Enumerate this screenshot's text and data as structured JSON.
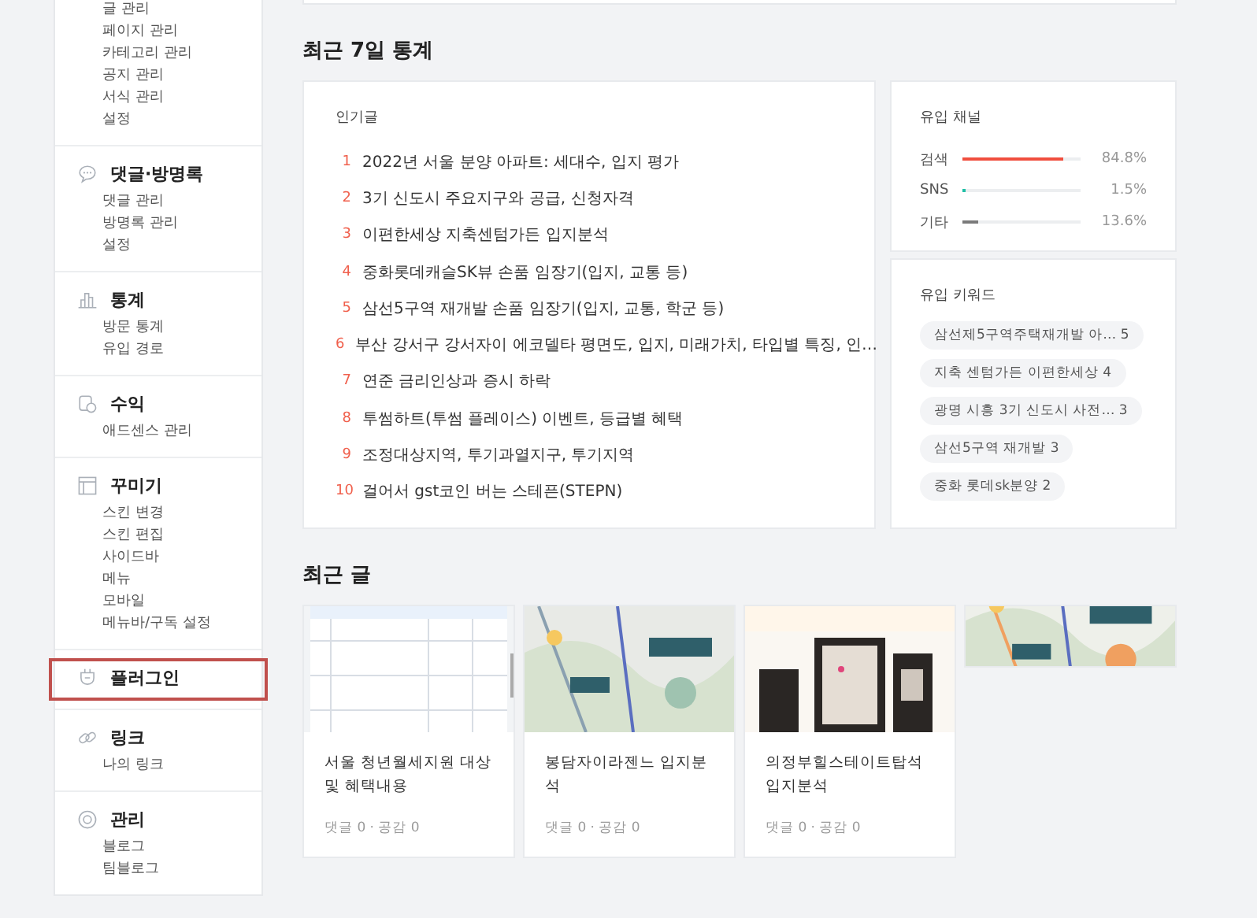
{
  "sidebar": {
    "sections": [
      {
        "highlighted": false,
        "items": [
          "글 관리",
          "페이지 관리",
          "카테고리 관리",
          "공지 관리",
          "서식 관리",
          "설정"
        ]
      },
      {
        "title": "댓글·방명록",
        "kind": "comment",
        "highlighted": false,
        "items": [
          "댓글 관리",
          "방명록 관리",
          "설정"
        ]
      },
      {
        "title": "통계",
        "kind": "chart",
        "highlighted": false,
        "items": [
          "방문 통계",
          "유입 경로"
        ]
      },
      {
        "title": "수익",
        "kind": "coins",
        "highlighted": false,
        "items": [
          "애드센스 관리"
        ]
      },
      {
        "title": "꾸미기",
        "kind": "layout",
        "highlighted": false,
        "items": [
          "스킨 변경",
          "스킨 편집",
          "사이드바",
          "메뉴",
          "모바일",
          "메뉴바/구독 설정"
        ]
      },
      {
        "title": "플러그인",
        "kind": "plug",
        "highlighted": true
      },
      {
        "title": "링크",
        "kind": "link",
        "highlighted": false,
        "items": [
          "나의 링크"
        ]
      },
      {
        "title": "관리",
        "kind": "gear",
        "highlighted": false,
        "items": [
          "블로그",
          "팀블로그"
        ]
      }
    ]
  },
  "stats": {
    "heading": "최근 7일 통계",
    "popular": {
      "title": "인기글",
      "posts": [
        {
          "rank": "1",
          "title": "2022년 서울 분양 아파트: 세대수, 입지 평가"
        },
        {
          "rank": "2",
          "title": "3기 신도시 주요지구와 공급, 신청자격"
        },
        {
          "rank": "3",
          "title": "이편한세상 지축센텀가든 입지분석"
        },
        {
          "rank": "4",
          "title": "중화롯데캐슬SK뷰 손품 임장기(입지, 교통 등)"
        },
        {
          "rank": "5",
          "title": "삼선5구역 재개발 손품 임장기(입지, 교통, 학군 등)"
        },
        {
          "rank": "6",
          "title": "부산 강서구 강서자이 에코델타 평면도, 입지, 미래가치, 타입별 특징, 인…"
        },
        {
          "rank": "7",
          "title": "연준 금리인상과 증시 하락"
        },
        {
          "rank": "8",
          "title": "투썸하트(투썸 플레이스) 이벤트, 등급별 혜택"
        },
        {
          "rank": "9",
          "title": "조정대상지역, 투기과열지구, 투기지역"
        },
        {
          "rank": "10",
          "title": "걸어서 gst코인 버는 스테픈(STEPN)"
        }
      ]
    },
    "channels": {
      "title": "유입 채널",
      "rows": [
        {
          "name": "검색",
          "level": 0.848,
          "reading": "84.8%",
          "color": "#f04e3e"
        },
        {
          "name": "SNS",
          "level": 0.015,
          "reading": "1.5%",
          "color": "#1fbfa5"
        },
        {
          "name": "기타",
          "level": 0.136,
          "reading": "13.6%",
          "color": "#7a7a7a"
        }
      ]
    },
    "keywords": {
      "title": "유입 키워드",
      "tags": [
        {
          "text": "삼선제5구역주택재개발 아…",
          "count": "5"
        },
        {
          "text": "지축 센텀가든 이편한세상",
          "count": "4"
        },
        {
          "text": "광명 시흥 3기 신도시 사전…",
          "count": "3"
        },
        {
          "text": "삼선5구역 재개발",
          "count": "3"
        },
        {
          "text": "중화 롯데sk분양",
          "count": "2"
        }
      ]
    }
  },
  "recent": {
    "heading": "최근 글",
    "posts": [
      {
        "kind": "picture",
        "title": "서울 청년월세지원 대상 및 혜택내용",
        "stats": "댓글 0 · 공감 0"
      },
      {
        "kind": "picture",
        "title": "봉담자이라젠느 입지분석",
        "stats": "댓글 0 · 공감 0"
      },
      {
        "kind": "picture",
        "title": "의정부힐스테이트탑석 입지분석",
        "stats": "댓글 0 · 공감 0"
      },
      {
        "kind": "picture"
      }
    ]
  }
}
